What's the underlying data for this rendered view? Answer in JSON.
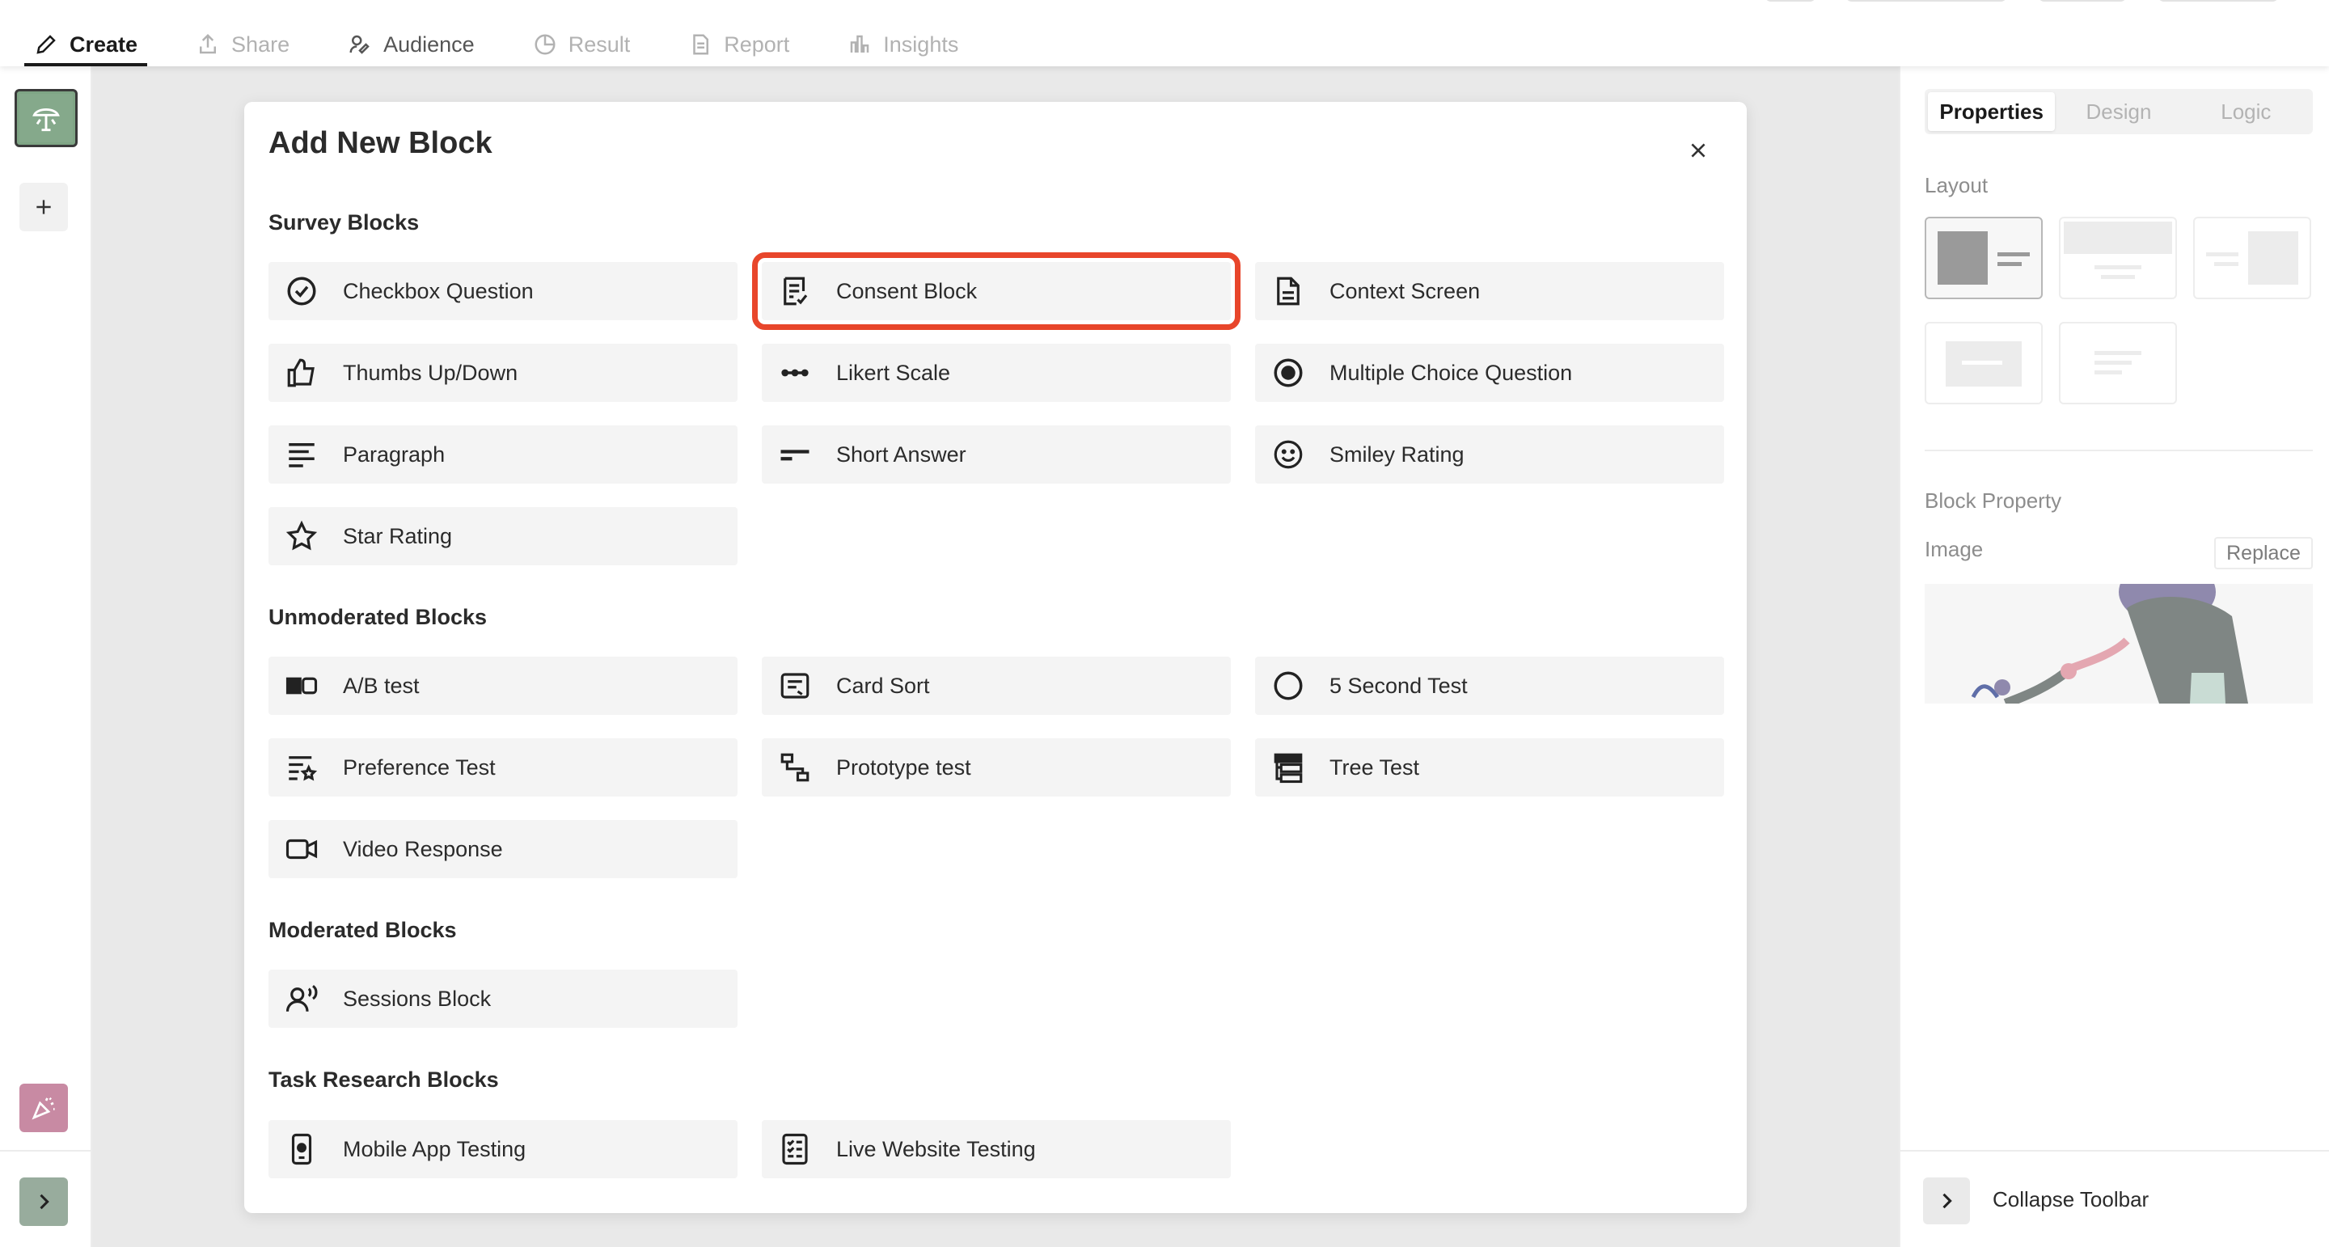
{
  "nav": {
    "tabs": [
      {
        "label": "Create",
        "icon": "pencil-icon",
        "active": true
      },
      {
        "label": "Share",
        "icon": "share-icon"
      },
      {
        "label": "Audience",
        "icon": "audience-icon"
      },
      {
        "label": "Result",
        "icon": "result-icon"
      },
      {
        "label": "Report",
        "icon": "report-icon"
      },
      {
        "label": "Insights",
        "icon": "insights-icon"
      }
    ]
  },
  "modal": {
    "title": "Add New Block",
    "sections": [
      {
        "title": "Survey Blocks",
        "blocks": [
          {
            "label": "Checkbox Question",
            "icon": "check-circle-icon"
          },
          {
            "label": "Consent Block",
            "icon": "consent-icon",
            "highlighted": true
          },
          {
            "label": "Context Screen",
            "icon": "document-icon"
          },
          {
            "label": "Thumbs Up/Down",
            "icon": "thumbs-up-icon"
          },
          {
            "label": "Likert Scale",
            "icon": "likert-icon"
          },
          {
            "label": "Multiple Choice Question",
            "icon": "radio-icon"
          },
          {
            "label": "Paragraph",
            "icon": "paragraph-icon"
          },
          {
            "label": "Short Answer",
            "icon": "short-answer-icon"
          },
          {
            "label": "Smiley Rating",
            "icon": "smiley-icon"
          },
          {
            "label": "Star Rating",
            "icon": "star-icon"
          }
        ]
      },
      {
        "title": "Unmoderated Blocks",
        "blocks": [
          {
            "label": "A/B test",
            "icon": "ab-test-icon"
          },
          {
            "label": "Card Sort",
            "icon": "card-sort-icon"
          },
          {
            "label": "5 Second Test",
            "icon": "circle-icon"
          },
          {
            "label": "Preference Test",
            "icon": "preference-icon"
          },
          {
            "label": "Prototype test",
            "icon": "prototype-icon"
          },
          {
            "label": "Tree Test",
            "icon": "tree-test-icon"
          },
          {
            "label": "Video Response",
            "icon": "video-icon"
          }
        ]
      },
      {
        "title": "Moderated Blocks",
        "blocks": [
          {
            "label": "Sessions Block",
            "icon": "sessions-icon"
          }
        ]
      },
      {
        "title": "Task Research Blocks",
        "blocks": [
          {
            "label": "Mobile App Testing",
            "icon": "mobile-icon"
          },
          {
            "label": "Live Website Testing",
            "icon": "checklist-icon"
          }
        ]
      }
    ]
  },
  "right_panel": {
    "tabs": [
      "Properties",
      "Design",
      "Logic"
    ],
    "active_tab": "Properties",
    "layout_label": "Layout",
    "block_property_label": "Block Property",
    "image_label": "Image",
    "replace_label": "Replace",
    "collapse_label": "Collapse Toolbar"
  },
  "colors": {
    "highlight": "#e8462b",
    "thumbnail": "#7fa585",
    "party_button": "#c88aa3",
    "expand_button": "#98ac9d"
  }
}
